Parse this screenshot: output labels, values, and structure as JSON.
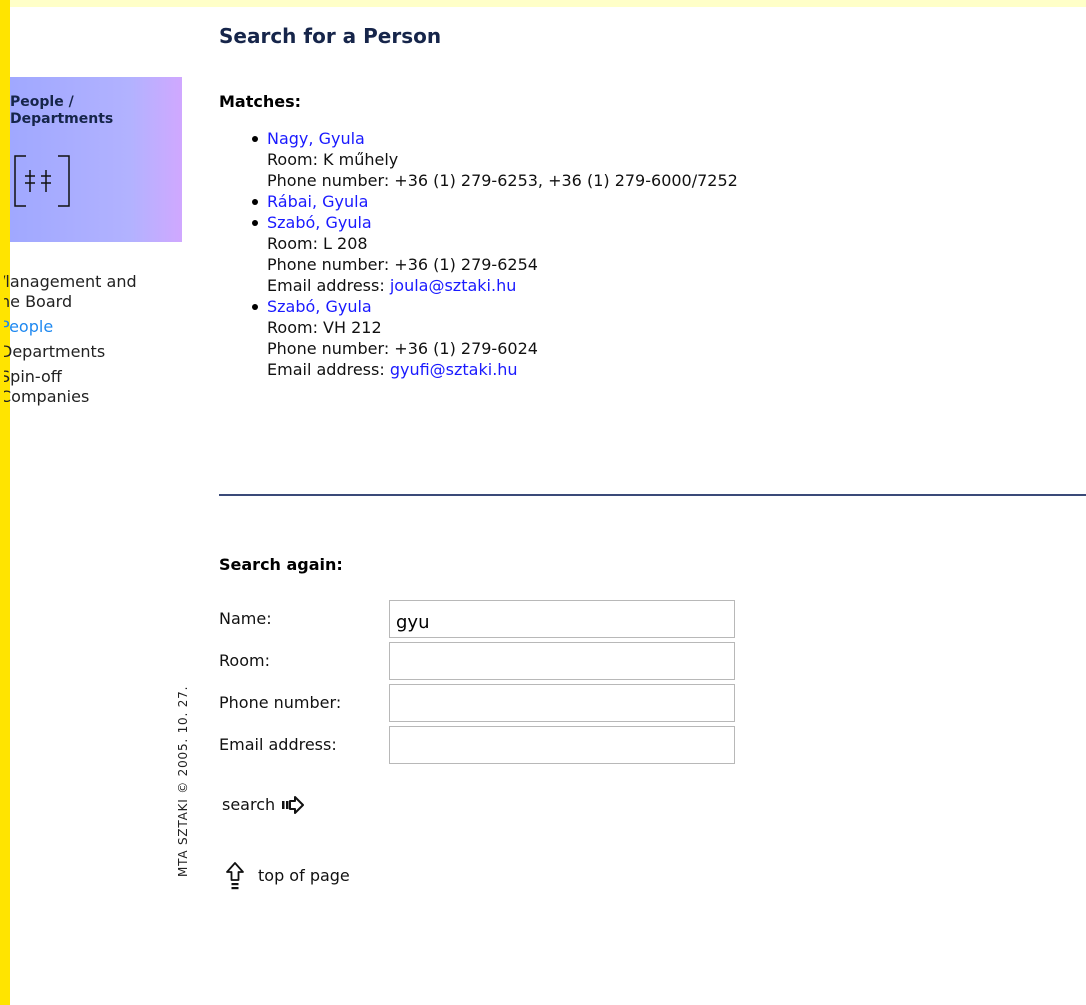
{
  "page_title": "Search for a Person",
  "section": {
    "label": "People / Departments",
    "icon": "people-departments-icon"
  },
  "side_nav": [
    {
      "label": "Management and the Board",
      "visible_text": "/lanagement and\nhe Board",
      "current": false
    },
    {
      "label": "People",
      "visible_text": "People",
      "current": true
    },
    {
      "label": "Departments",
      "visible_text": "Departments",
      "current": false
    },
    {
      "label": "Spin-off Companies",
      "visible_text": "Spin-off\nCompanies",
      "current": false
    }
  ],
  "matches": {
    "heading": "Matches:",
    "results": [
      {
        "name": "Nagy, Gyula",
        "room": "Room: K műhely",
        "phone": "Phone number: +36 (1) 279-6253, +36 (1) 279-6000/7252"
      },
      {
        "name": "Rábai, Gyula"
      },
      {
        "name": "Szabó, Gyula",
        "room": "Room: L 208",
        "phone": "Phone number: +36 (1) 279-6254",
        "email_label": "Email address:",
        "email": "joula@sztaki.hu"
      },
      {
        "name": "Szabó, Gyula",
        "room": "Room: VH 212",
        "phone": "Phone number: +36 (1) 279-6024",
        "email_label": "Email address:",
        "email": "gyufi@sztaki.hu"
      }
    ]
  },
  "search_again": {
    "heading": "Search again:",
    "fields": {
      "name": {
        "label": "Name:",
        "value": "gyu"
      },
      "room": {
        "label": "Room:",
        "value": ""
      },
      "phone": {
        "label": "Phone number:",
        "value": ""
      },
      "email": {
        "label": "Email address:",
        "value": ""
      }
    },
    "search_label": "search",
    "search_icon": "arrow-right-icon"
  },
  "top_link": {
    "label": "top of page",
    "icon": "arrow-up-icon"
  },
  "footer": "MTA SZTAKI © 2005. 10. 27.",
  "colors": {
    "accent_yellow": "#ffe400",
    "header_bg": "#ffffc8",
    "section_box": "#b2b2ff",
    "title": "#16254a",
    "link": "#1a1aff",
    "current_nav": "#1e88f0"
  }
}
